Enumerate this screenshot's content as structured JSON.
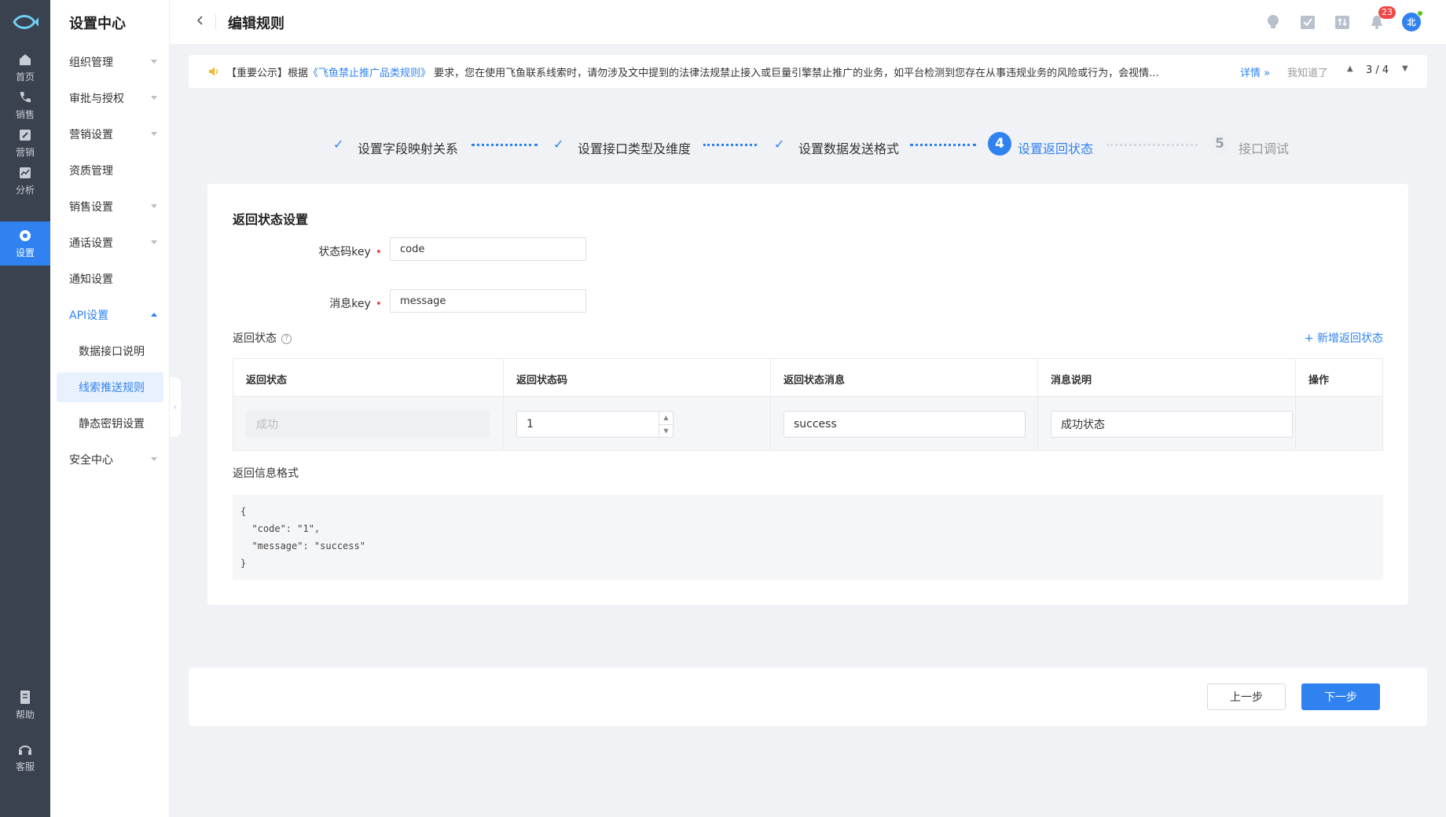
{
  "rail": {
    "items": [
      {
        "label": "首页",
        "icon": "home-icon"
      },
      {
        "label": "销售",
        "icon": "phone-icon"
      },
      {
        "label": "营销",
        "icon": "edit-icon"
      },
      {
        "label": "分析",
        "icon": "chart-icon"
      },
      {
        "label": "设置",
        "icon": "gear-icon",
        "active": true
      },
      {
        "label": "帮助",
        "icon": "book-icon"
      },
      {
        "label": "客服",
        "icon": "headset-icon"
      }
    ]
  },
  "menu": {
    "title": "设置中心",
    "items": [
      {
        "label": "组织管理",
        "caret": true
      },
      {
        "label": "审批与授权",
        "caret": true
      },
      {
        "label": "营销设置",
        "caret": true
      },
      {
        "label": "资质管理",
        "caret": false
      },
      {
        "label": "销售设置",
        "caret": true
      },
      {
        "label": "通话设置",
        "caret": true
      },
      {
        "label": "通知设置",
        "caret": false
      },
      {
        "label": "API设置",
        "caret": true,
        "open": true
      },
      {
        "label": "数据接口说明",
        "sub": true
      },
      {
        "label": "线索推送规则",
        "sub": true,
        "selected": true
      },
      {
        "label": "静态密钥设置",
        "sub": true
      },
      {
        "label": "安全中心",
        "caret": true
      }
    ]
  },
  "header": {
    "title": "编辑规则",
    "notification_count": "23",
    "avatar_text": "北"
  },
  "notice": {
    "prefix": "【重要公示】根据",
    "link": "《飞鱼禁止推广品类规则》",
    "body": "要求，您在使用飞鱼联系线索时，请勿涉及文中提到的法律法规禁止接入或巨量引擎禁止推广的业务，如平台检测到您存在从事违规业务的风险或行为，会视情...",
    "detail": "详情 »",
    "dismiss": "我知道了",
    "pager": "3 / 4"
  },
  "steps": [
    {
      "label": "设置字段映射关系",
      "state": "done"
    },
    {
      "label": "设置接口类型及维度",
      "state": "done"
    },
    {
      "label": "设置数据发送格式",
      "state": "done"
    },
    {
      "num": "4",
      "label": "设置返回状态",
      "state": "active"
    },
    {
      "num": "5",
      "label": "接口调试",
      "state": "pending"
    }
  ],
  "form": {
    "section_title": "返回状态设置",
    "status_key_label": "状态码key",
    "status_key_value": "code",
    "message_key_label": "消息key",
    "message_key_value": "message",
    "return_status_title": "返回状态",
    "add_status": "+ 新增返回状态",
    "table": {
      "headers": [
        "返回状态",
        "返回状态码",
        "返回状态消息",
        "消息说明",
        "操作"
      ],
      "row": {
        "status_placeholder": "成功",
        "code": "1",
        "message": "success",
        "description": "成功状态"
      }
    },
    "format_title": "返回信息格式",
    "format_code": "{\n  \"code\": \"1\",\n  \"message\": \"success\"\n}"
  },
  "footer": {
    "prev": "上一步",
    "next": "下一步"
  },
  "colors": {
    "accent": "#2f82f0",
    "rail_bg": "#3a4250",
    "required": "#f04848"
  }
}
